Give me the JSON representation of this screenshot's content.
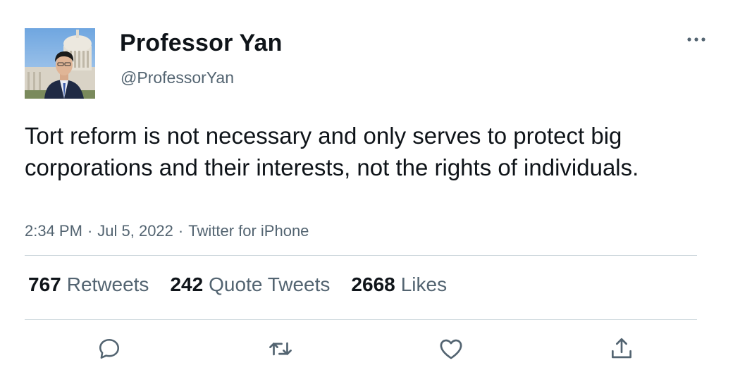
{
  "author": {
    "display_name": "Professor Yan",
    "handle": "@ProfessorYan"
  },
  "tweet": {
    "text": "Tort reform is not necessary and only serves to protect big corporations and their interests, not the rights of individuals.",
    "time": "2:34 PM",
    "date": "Jul 5, 2022",
    "source": "Twitter for iPhone",
    "separator": "·"
  },
  "stats": {
    "retweets_count": "767",
    "retweets_label": "Retweets",
    "quotes_count": "242",
    "quotes_label": "Quote Tweets",
    "likes_count": "2668",
    "likes_label": "Likes"
  },
  "actions": [
    "reply-icon",
    "retweet-icon",
    "like-icon",
    "share-icon"
  ],
  "colors": {
    "text_primary": "#0f1419",
    "text_secondary": "#536471",
    "divider": "#cfd9de"
  }
}
